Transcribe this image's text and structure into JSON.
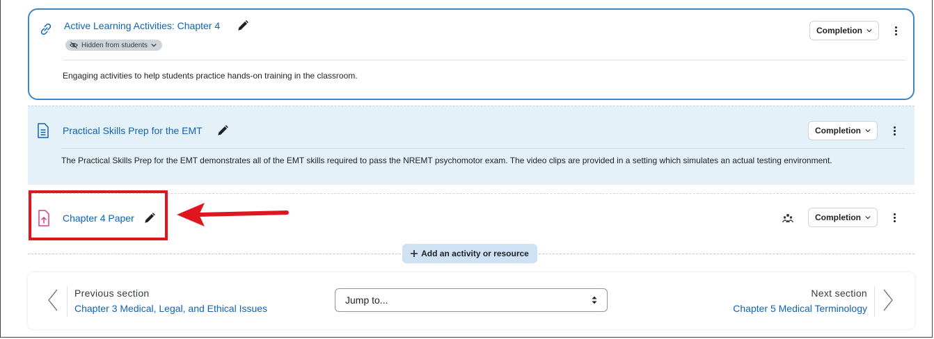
{
  "activities": [
    {
      "title": "Active Learning Activities: Chapter 4",
      "badge": "Hidden from students",
      "description": "Engaging activities to help students practice hands-on training in the classroom.",
      "completion": "Completion"
    },
    {
      "title": "Practical Skills Prep for the EMT",
      "description": "The Practical Skills Prep for the EMT demonstrates all of the EMT skills required to pass the NREMT psychomotor exam. The video clips are provided in a setting which simulates an actual testing environment.",
      "completion": "Completion"
    },
    {
      "title": "Chapter 4 Paper",
      "completion": "Completion"
    }
  ],
  "add_activity": "Add an activity or resource",
  "nav": {
    "previous_label": "Previous section",
    "previous_link": "Chapter 3 Medical, Legal, and Ethical Issues",
    "jump_placeholder": "Jump to...",
    "next_label": "Next section",
    "next_link": "Chapter 5 Medical Terminology"
  },
  "colors": {
    "link": "#0f62b0",
    "highlight_border": "#3b86c6",
    "highlight_bg": "#e4f1f8",
    "add_button_bg": "#cfe2f3",
    "annotation_red": "#e0161e",
    "assignment_icon": "#e0388c"
  },
  "icons": {
    "activity1": "link-icon",
    "activity2": "page-icon",
    "activity3": "assignment-upload-icon"
  }
}
